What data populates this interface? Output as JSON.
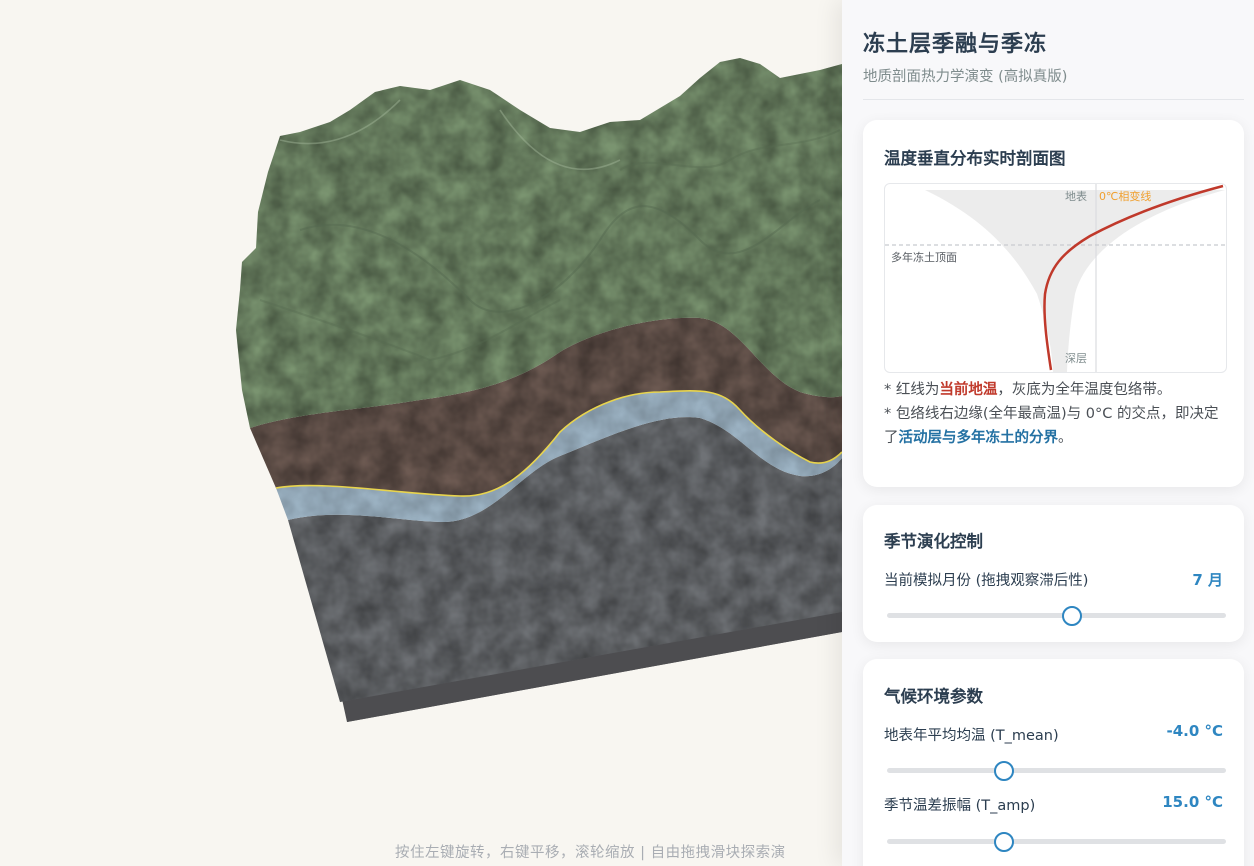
{
  "panel": {
    "title": "冻土层季融与季冻",
    "subtitle": "地质剖面热力学演变 (高拟真版)"
  },
  "profile_card": {
    "title": "温度垂直分布实时剖面图",
    "chart_labels": {
      "surface": "地表",
      "zero_line": "0℃相变线",
      "permafrost_top": "多年冻土顶面",
      "deep": "深层"
    },
    "note1": {
      "prefix": "* 红线为",
      "highlight": "当前地温",
      "suffix": "，灰底为全年温度包络带。"
    },
    "note2": {
      "prefix": "* 包络线右边缘(全年最高温)与 0°C 的交点，即决定了",
      "highlight": "活动层与多年冻土的分界",
      "suffix": "。"
    }
  },
  "season_card": {
    "title": "季节演化控制",
    "month_label": "当前模拟月份 (拖拽观察滞后性)",
    "month_value": "7 月",
    "month_fraction": 0.545
  },
  "climate_card": {
    "title": "气候环境参数",
    "tmean_label": "地表年平均均温 (T_mean)",
    "tmean_value": "-4.0 °C",
    "tmean_fraction": 0.345,
    "tamp_label": "季节温差振幅 (T_amp)",
    "tamp_value": "15.0 °C",
    "tamp_fraction": 0.345
  },
  "hint": "按住左键旋转，右键平移，滚轮缩放 | 自由拖拽滑块探索演",
  "colors": {
    "accent": "#2e86c1",
    "current_temp": "#c0392b",
    "zero_line": "#f0a030",
    "boundary": "#e8d44d",
    "vegetation": "#7a9470",
    "soil": "#6d5a52",
    "ice_layer": "#9fb6c7",
    "bedrock": "#6f7276"
  }
}
